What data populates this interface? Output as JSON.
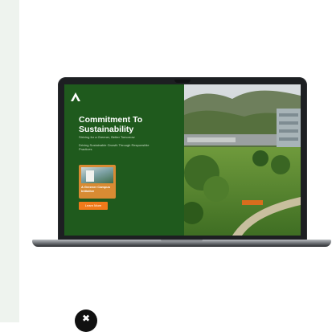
{
  "slide": {
    "headline": "Commitment To Sustainability",
    "subline": "Striving for a Greener, Better Tomorrow",
    "description": "Driving Sustainable Growth Through Responsible Practices",
    "card_text": "A Greener Campus Initiative",
    "cta_label": "Learn More"
  },
  "icons": {
    "logo": "mountain-logo-icon",
    "footer": "close-icon",
    "footer_glyph": "✖"
  },
  "colors": {
    "panel_green": "#1f5a1d",
    "cta_orange": "#f07a1a",
    "card_orange": "#d88b33"
  }
}
